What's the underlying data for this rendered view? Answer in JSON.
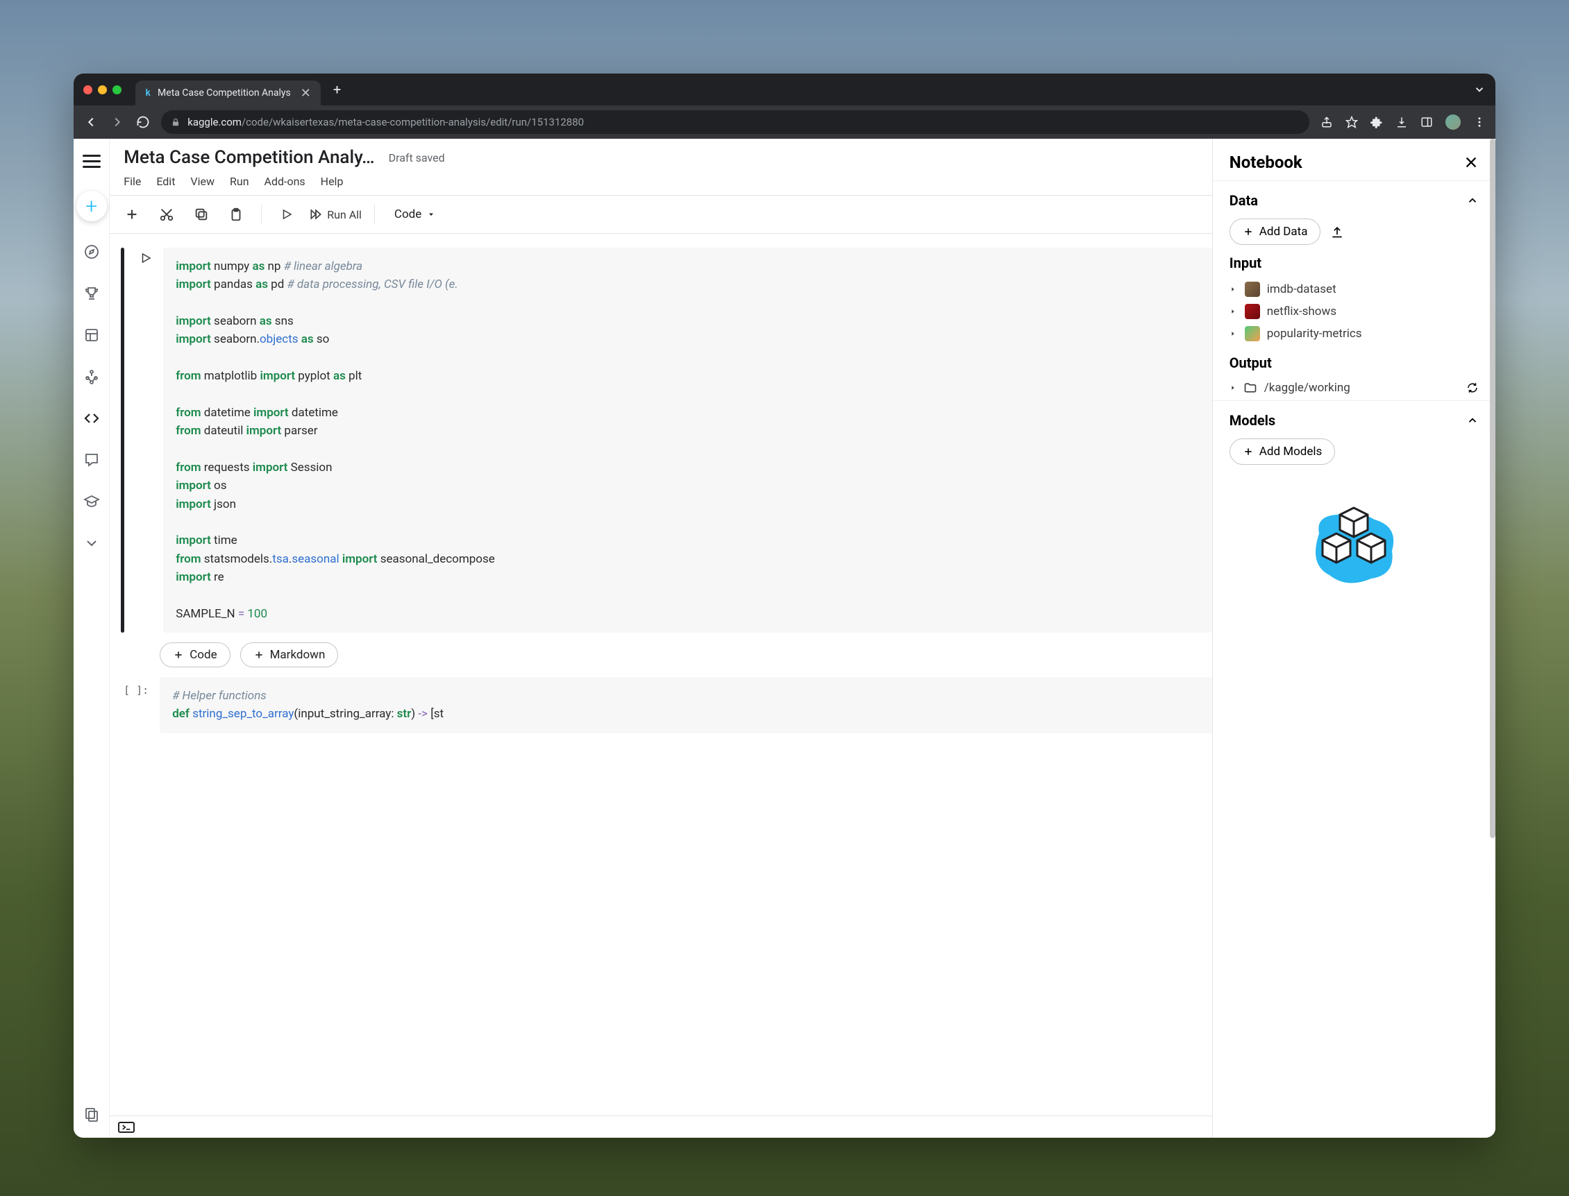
{
  "browser": {
    "tab_title": "Meta Case Competition Analys",
    "url_host": "kaggle.com",
    "url_path": "/code/wkaisertexas/meta-case-competition-analysis/edit/run/151312880"
  },
  "notebook": {
    "title": "Meta Case Competition Analy…",
    "status": "Draft saved",
    "menu": {
      "file": "File",
      "edit": "Edit",
      "view": "View",
      "run": "Run",
      "addons": "Add-ons",
      "help": "Help"
    },
    "toolbar": {
      "runall": "Run All",
      "celltype": "Code"
    },
    "cell1": {
      "l1_kw": "import",
      "l1_mod": " numpy ",
      "l1_as": "as",
      "l1_al": " np ",
      "l1_cmt": "# linear algebra",
      "l2_kw": "import",
      "l2_mod": " pandas ",
      "l2_as": "as",
      "l2_al": " pd ",
      "l2_cmt": "# data processing, CSV file I/O (e.",
      "l3_kw": "import",
      "l3_mod": " seaborn ",
      "l3_as": "as",
      "l3_al": " sns",
      "l4_kw": "import",
      "l4_mod": " seaborn.",
      "l4_attr": "objects",
      "l4_sp": " ",
      "l4_as": "as",
      "l4_al": " so",
      "l5_kw": "from",
      "l5_mod": " matplotlib ",
      "l5_imp": "import",
      "l5_sp": " pyplot ",
      "l5_as": "as",
      "l5_al": " plt",
      "l6_kw": "from",
      "l6_mod": " datetime ",
      "l6_imp": "import",
      "l6_al": " datetime",
      "l7_kw": "from",
      "l7_mod": " dateutil ",
      "l7_imp": "import",
      "l7_al": " parser",
      "l8_kw": "from",
      "l8_mod": " requests ",
      "l8_imp": "import",
      "l8_al": " Session",
      "l9_kw": "import",
      "l9_al": " os",
      "l10_kw": "import",
      "l10_al": " json",
      "l11_kw": "import",
      "l11_al": " time",
      "l12_kw": "from",
      "l12_mod": " statsmodels.",
      "l12_a": "tsa",
      "l12_d": ".",
      "l12_b": "seasonal",
      "l12_sp": " ",
      "l12_imp": "import",
      "l12_al": " seasonal_decompose",
      "l13_kw": "import",
      "l13_al": " re",
      "l14_v": "SAMPLE_N ",
      "l14_op": "=",
      "l14_sp": " ",
      "l14_n": "100"
    },
    "addcell": {
      "code": "Code",
      "markdown": "Markdown"
    },
    "cell2": {
      "prompt": "[ ]:",
      "l1_cmt": "# Helper functions",
      "l2_def": "def",
      "l2_sp": " ",
      "l2_fn": "string_sep_to_array",
      "l2_p1": "(input_string_array: ",
      "l2_t": "str",
      "l2_p2": ") ",
      "l2_ar": "->",
      "l2_p3": " [st"
    }
  },
  "rpanel": {
    "title": "Notebook",
    "data": {
      "heading": "Data",
      "add": "Add Data",
      "input_heading": "Input",
      "datasets": [
        {
          "name": "imdb-dataset",
          "color1": "#8b6d4a",
          "color2": "#5a4430"
        },
        {
          "name": "netflix-shows",
          "color1": "#b01418",
          "color2": "#6a0a0c"
        },
        {
          "name": "popularity-metrics",
          "color1": "#55c879",
          "color2": "#f0a050"
        }
      ],
      "output_heading": "Output",
      "output_path": "/kaggle/working"
    },
    "models": {
      "heading": "Models",
      "add": "Add Models"
    }
  }
}
